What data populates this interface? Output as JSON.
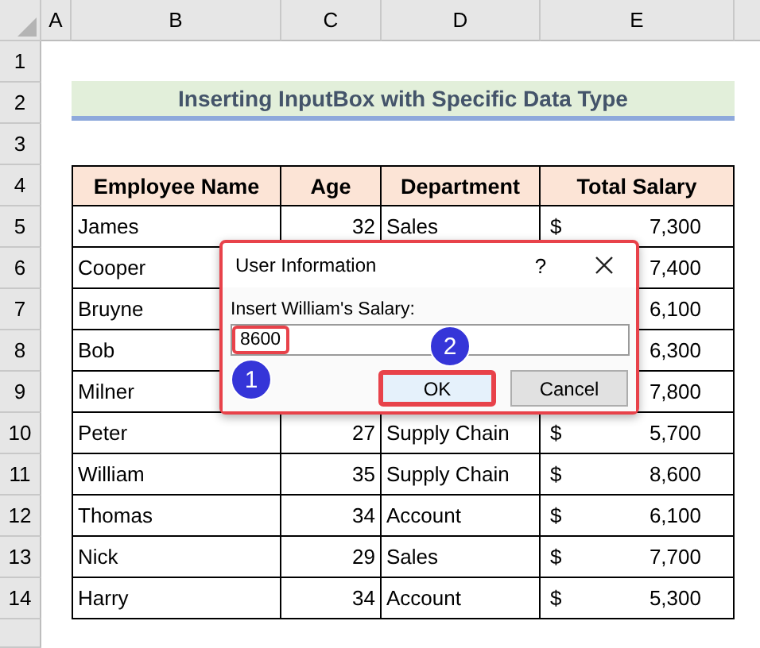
{
  "columns": [
    "A",
    "B",
    "C",
    "D",
    "E"
  ],
  "row_numbers": [
    "1",
    "2",
    "3",
    "4",
    "5",
    "6",
    "7",
    "8",
    "9",
    "10",
    "11",
    "12",
    "13",
    "14"
  ],
  "title": "Inserting InputBox with Specific Data Type",
  "table": {
    "headers": [
      "Employee Name",
      "Age",
      "Department",
      "Total Salary"
    ],
    "rows": [
      {
        "name": "James",
        "age": "32",
        "department": "Sales",
        "currency": "$",
        "salary": "7,300"
      },
      {
        "name": "Cooper",
        "salary": "7,400"
      },
      {
        "name": "Bruyne",
        "salary": "6,100"
      },
      {
        "name": "Bob",
        "salary": "6,300"
      },
      {
        "name": "Milner",
        "salary": "7,800"
      },
      {
        "name": "Peter",
        "age": "27",
        "department": "Supply Chain",
        "currency": "$",
        "salary": "5,700"
      },
      {
        "name": "William",
        "age": "35",
        "department": "Supply Chain",
        "currency": "$",
        "salary": "8,600"
      },
      {
        "name": "Thomas",
        "age": "34",
        "department": "Account",
        "currency": "$",
        "salary": "6,100"
      },
      {
        "name": "Nick",
        "age": "29",
        "department": "Sales",
        "currency": "$",
        "salary": "7,700"
      },
      {
        "name": "Harry",
        "age": "34",
        "department": "Account",
        "currency": "$",
        "salary": "5,300"
      }
    ]
  },
  "dialog": {
    "title": "User Information",
    "help": "?",
    "prompt": "Insert William's Salary:",
    "value": "8600",
    "value_highlighted": true,
    "buttons": [
      {
        "label": "OK",
        "default": true,
        "highlighted": true
      },
      {
        "label": "Cancel",
        "default": false,
        "highlighted": false
      }
    ],
    "callouts": [
      "1",
      "2"
    ]
  }
}
